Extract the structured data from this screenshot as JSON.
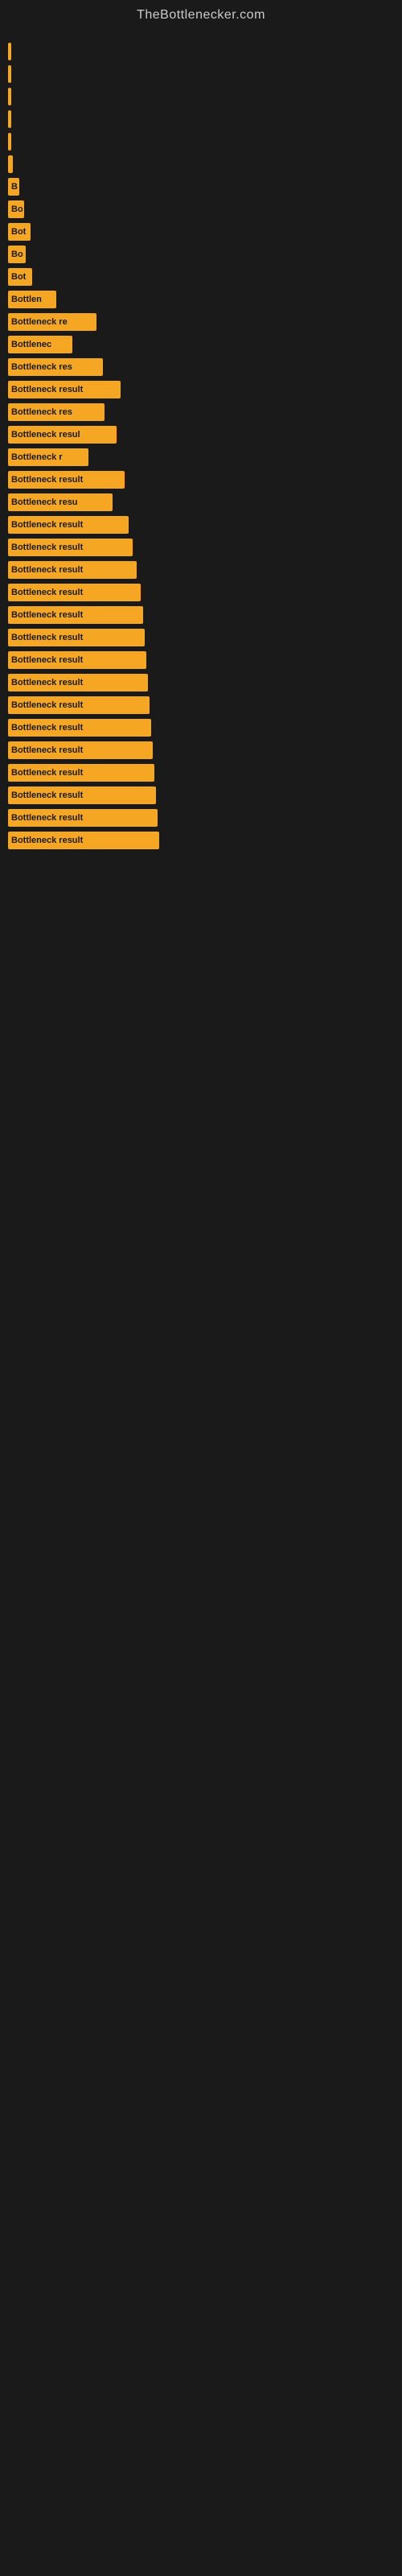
{
  "site": {
    "title": "TheBottlenecker.com"
  },
  "bars": [
    {
      "label": "",
      "width": 2
    },
    {
      "label": "",
      "width": 3
    },
    {
      "label": "",
      "width": 4
    },
    {
      "label": "",
      "width": 3
    },
    {
      "label": "",
      "width": 3
    },
    {
      "label": "",
      "width": 6
    },
    {
      "label": "B",
      "width": 14
    },
    {
      "label": "Bo",
      "width": 20
    },
    {
      "label": "Bot",
      "width": 28
    },
    {
      "label": "Bo",
      "width": 22
    },
    {
      "label": "Bot",
      "width": 30
    },
    {
      "label": "Bottlen",
      "width": 60
    },
    {
      "label": "Bottleneck re",
      "width": 110
    },
    {
      "label": "Bottlenec",
      "width": 80
    },
    {
      "label": "Bottleneck res",
      "width": 118
    },
    {
      "label": "Bottleneck result",
      "width": 140
    },
    {
      "label": "Bottleneck res",
      "width": 120
    },
    {
      "label": "Bottleneck resul",
      "width": 135
    },
    {
      "label": "Bottleneck r",
      "width": 100
    },
    {
      "label": "Bottleneck result",
      "width": 145
    },
    {
      "label": "Bottleneck resu",
      "width": 130
    },
    {
      "label": "Bottleneck result",
      "width": 150
    },
    {
      "label": "Bottleneck result",
      "width": 155
    },
    {
      "label": "Bottleneck result",
      "width": 160
    },
    {
      "label": "Bottleneck result",
      "width": 165
    },
    {
      "label": "Bottleneck result",
      "width": 168
    },
    {
      "label": "Bottleneck result",
      "width": 170
    },
    {
      "label": "Bottleneck result",
      "width": 172
    },
    {
      "label": "Bottleneck result",
      "width": 174
    },
    {
      "label": "Bottleneck result",
      "width": 176
    },
    {
      "label": "Bottleneck result",
      "width": 178
    },
    {
      "label": "Bottleneck result",
      "width": 180
    },
    {
      "label": "Bottleneck result",
      "width": 182
    },
    {
      "label": "Bottleneck result",
      "width": 184
    },
    {
      "label": "Bottleneck result",
      "width": 186
    },
    {
      "label": "Bottleneck result",
      "width": 188
    }
  ]
}
